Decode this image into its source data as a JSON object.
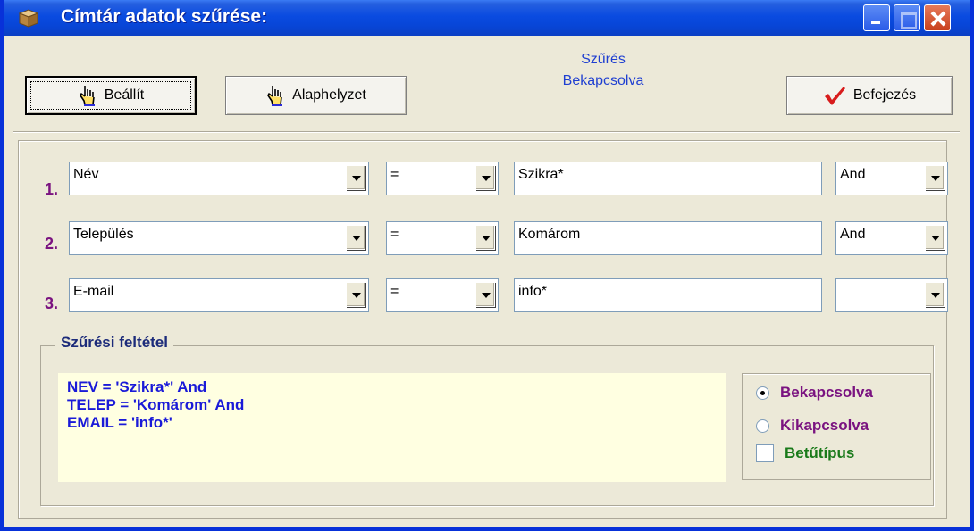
{
  "window": {
    "title": "Címtár adatok szűrése:"
  },
  "toolbar": {
    "apply_label": "Beállít",
    "reset_label": "Alaphelyzet",
    "finish_label": "Befejezés",
    "status_line1": "Szűrés",
    "status_line2": "Bekapcsolva"
  },
  "filters": [
    {
      "number": "1.",
      "field": "Név",
      "operator": "=",
      "value": "Szikra*",
      "logic": "And"
    },
    {
      "number": "2.",
      "field": "Település",
      "operator": "=",
      "value": "Komárom",
      "logic": "And"
    },
    {
      "number": "3.",
      "field": "E-mail",
      "operator": "=",
      "value": "info*",
      "logic": ""
    }
  ],
  "condition": {
    "legend": "Szűrési feltétel",
    "lines": [
      "NEV = 'Szikra*' And",
      "TELEP = 'Komárom' And",
      "EMAIL = 'info*'"
    ]
  },
  "options": {
    "on_label": "Bekapcsolva",
    "off_label": "Kikapcsolva",
    "font_label": "Betűtípus",
    "selected": "on",
    "font_checked": false,
    "on_color": "#7a1380",
    "font_color": "#1a7a1a"
  }
}
